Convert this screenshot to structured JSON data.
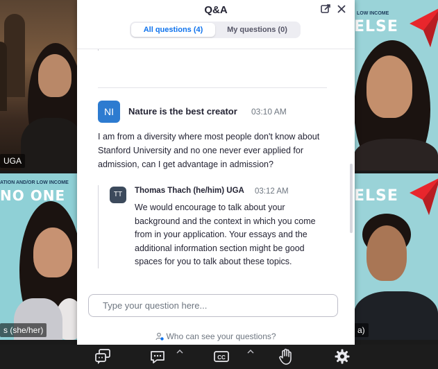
{
  "qa": {
    "title": "Q&A",
    "tabs": [
      {
        "label": "All questions (4)",
        "active": true
      },
      {
        "label": "My questions (0)",
        "active": false
      }
    ],
    "question": {
      "avatar_initials": "NI",
      "avatar_color": "#2d7bd0",
      "author": "Nature is the best creator",
      "time": "03:10 AM",
      "text": "I am from a diversity where most people don't know about Stanford University and no one never ever applied for admission, can I get advantage in admission?"
    },
    "answer": {
      "avatar_initials": "TT",
      "author": "Thomas Thach (he/him) UGA",
      "time": "03:12 AM",
      "text": "We would encourage to talk about your background and the context in which you come from in your application. Your essays and the additional information section might be good spaces for you to talk about these topics."
    },
    "input_placeholder": "Type your question here...",
    "footer_note": "Who can see your questions?"
  },
  "videos": {
    "top_left_name": "UGA",
    "bottom_left_name": "s (she/her)",
    "bottom_right_name": "a)",
    "banner_top_right_small": "LOW INCOME",
    "banner_top_right_big": "ELSE",
    "banner_bottom_left_small": "ATION AND/OR LOW INCOME",
    "banner_bottom_left_big": "NO ONE",
    "banner_bottom_right_big": "ELSE"
  },
  "toolbar": {
    "icons": [
      "qa-icon",
      "chat-icon",
      "captions-icon",
      "raise-hand-icon",
      "settings-icon"
    ],
    "captions_label": "CC"
  },
  "colors": {
    "accent": "#0e72ed",
    "banner_bg": "#9ad3d8",
    "banner_red": "#e8262c"
  }
}
